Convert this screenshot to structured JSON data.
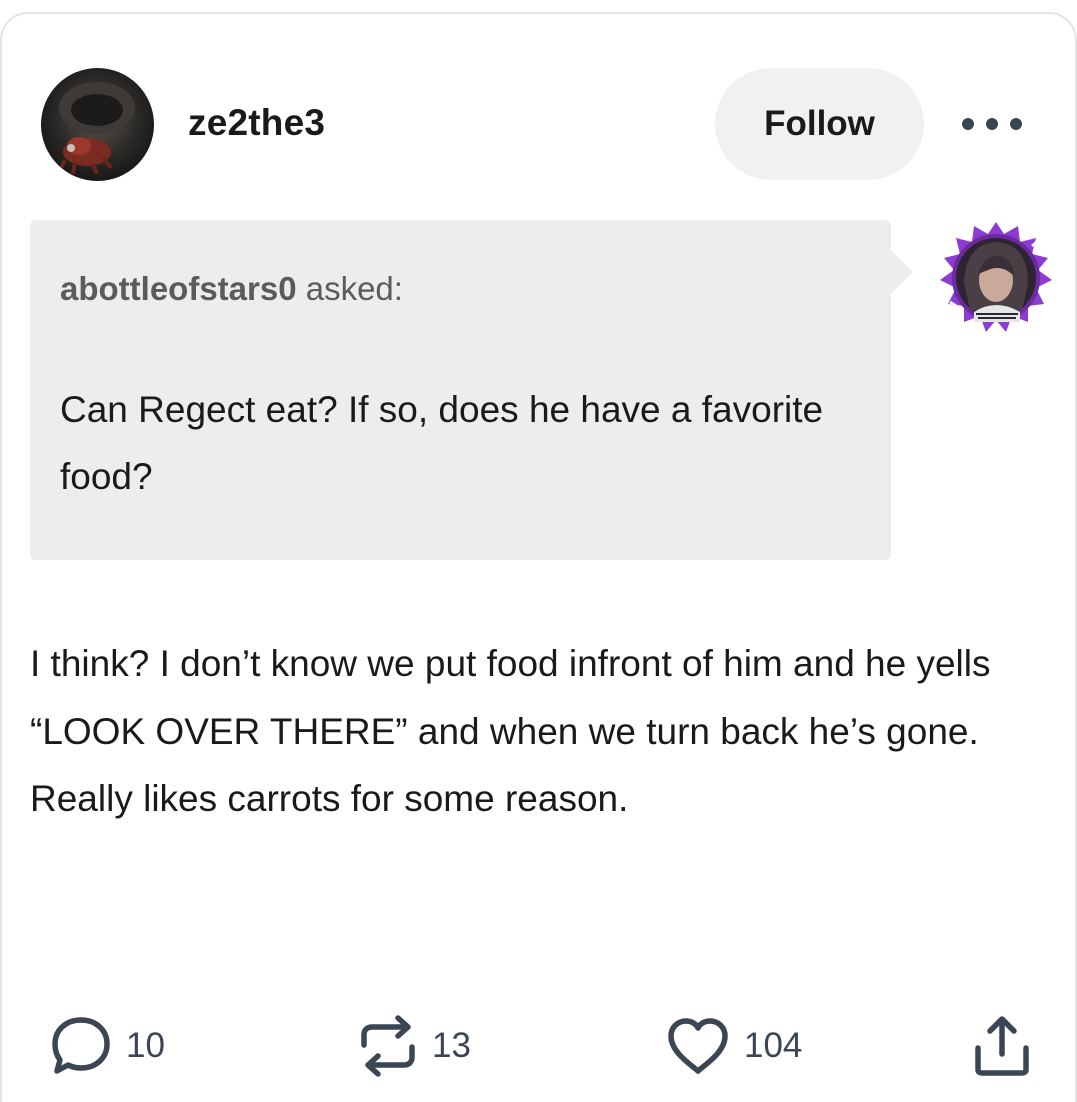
{
  "post": {
    "username": "ze2the3",
    "follow_label": "Follow",
    "ask": {
      "asker": "abottleofstars0",
      "asked_label": " asked:",
      "question": "Can Regect eat? If so, does he have a favorite food?"
    },
    "answer": "I think? I don’t know we put food infront of him and he yells “LOOK OVER THERE” and when we turn back he’s gone. Really likes carrots for some reason.",
    "footer": {
      "replies": "10",
      "reblogs": "13",
      "likes": "104"
    }
  },
  "icons": {
    "more": "more-options-icon",
    "replies": "speech-bubble-icon",
    "reblogs": "reblog-icon",
    "likes": "heart-icon",
    "share": "share-icon"
  },
  "colors": {
    "icon": "#3b4554",
    "ask_background": "#ededed",
    "follow_background": "#f1f1f1",
    "asker_avatar_accent": "#8e3bd1"
  }
}
